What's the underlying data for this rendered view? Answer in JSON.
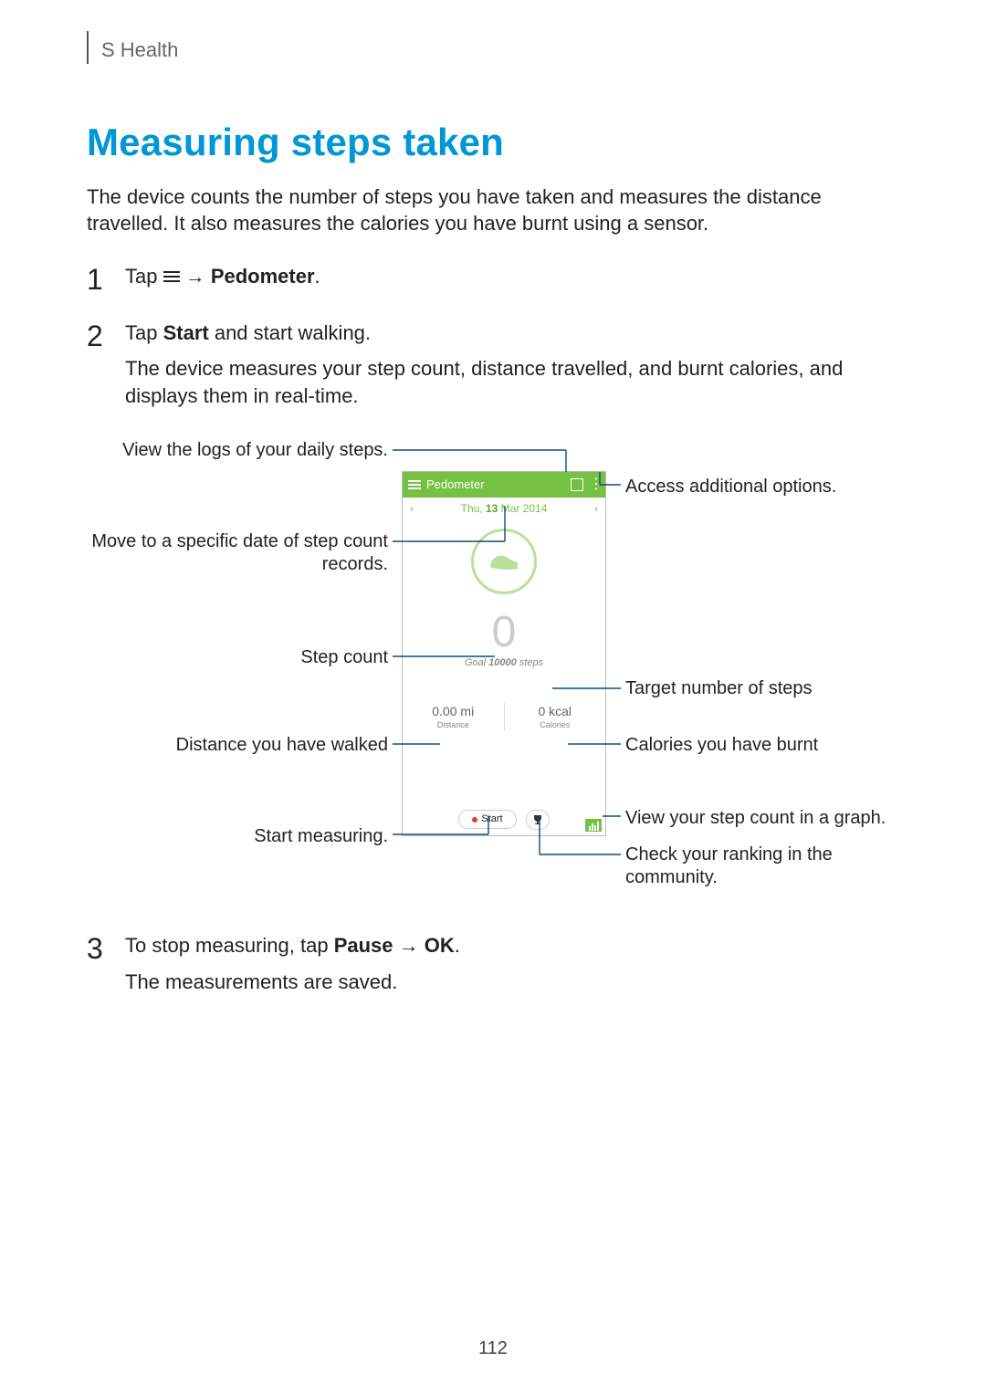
{
  "breadcrumb": "S Health",
  "title": "Measuring steps taken",
  "intro": "The device counts the number of steps you have taken and measures the distance travelled. It also measures the calories you have burnt using a sensor.",
  "steps": {
    "s1": {
      "num": "1",
      "prefix": "Tap ",
      "arrow": " → ",
      "target": "Pedometer",
      "suffix": "."
    },
    "s2": {
      "num": "2",
      "line1a": "Tap ",
      "line1b": "Start",
      "line1c": " and start walking.",
      "line2": "The device measures your step count, distance travelled, and burnt calories, and displays them in real-time."
    },
    "s3": {
      "num": "3",
      "line1a": "To stop measuring, tap ",
      "line1b": "Pause",
      "line1arrow": " → ",
      "line1c": "OK",
      "line1d": ".",
      "line2": "The measurements are saved."
    }
  },
  "callouts": {
    "logs": "View the logs of your daily steps.",
    "options": "Access additional options.",
    "moveDate": "Move to a specific date of step count records.",
    "stepCount": "Step count",
    "target": "Target number of steps",
    "distance": "Distance you have walked",
    "calories": "Calories you have burnt",
    "graph": "View your step count in a graph.",
    "startMeasuring": "Start measuring.",
    "ranking": "Check your ranking in the community."
  },
  "phone": {
    "title": "Pedometer",
    "datePrefix": "Thu, ",
    "dateBold": "13",
    "dateSuffix": " Mar 2014",
    "stepValue": "0",
    "goalPrefix": "Goal ",
    "goalValue": "10000",
    "goalSuffix": " steps",
    "distanceValue": "0.00 mi",
    "distanceLabel": "Distance",
    "caloriesValue": "0 kcal",
    "caloriesLabel": "Calories",
    "startLabel": "Start"
  },
  "pageNumber": "112"
}
